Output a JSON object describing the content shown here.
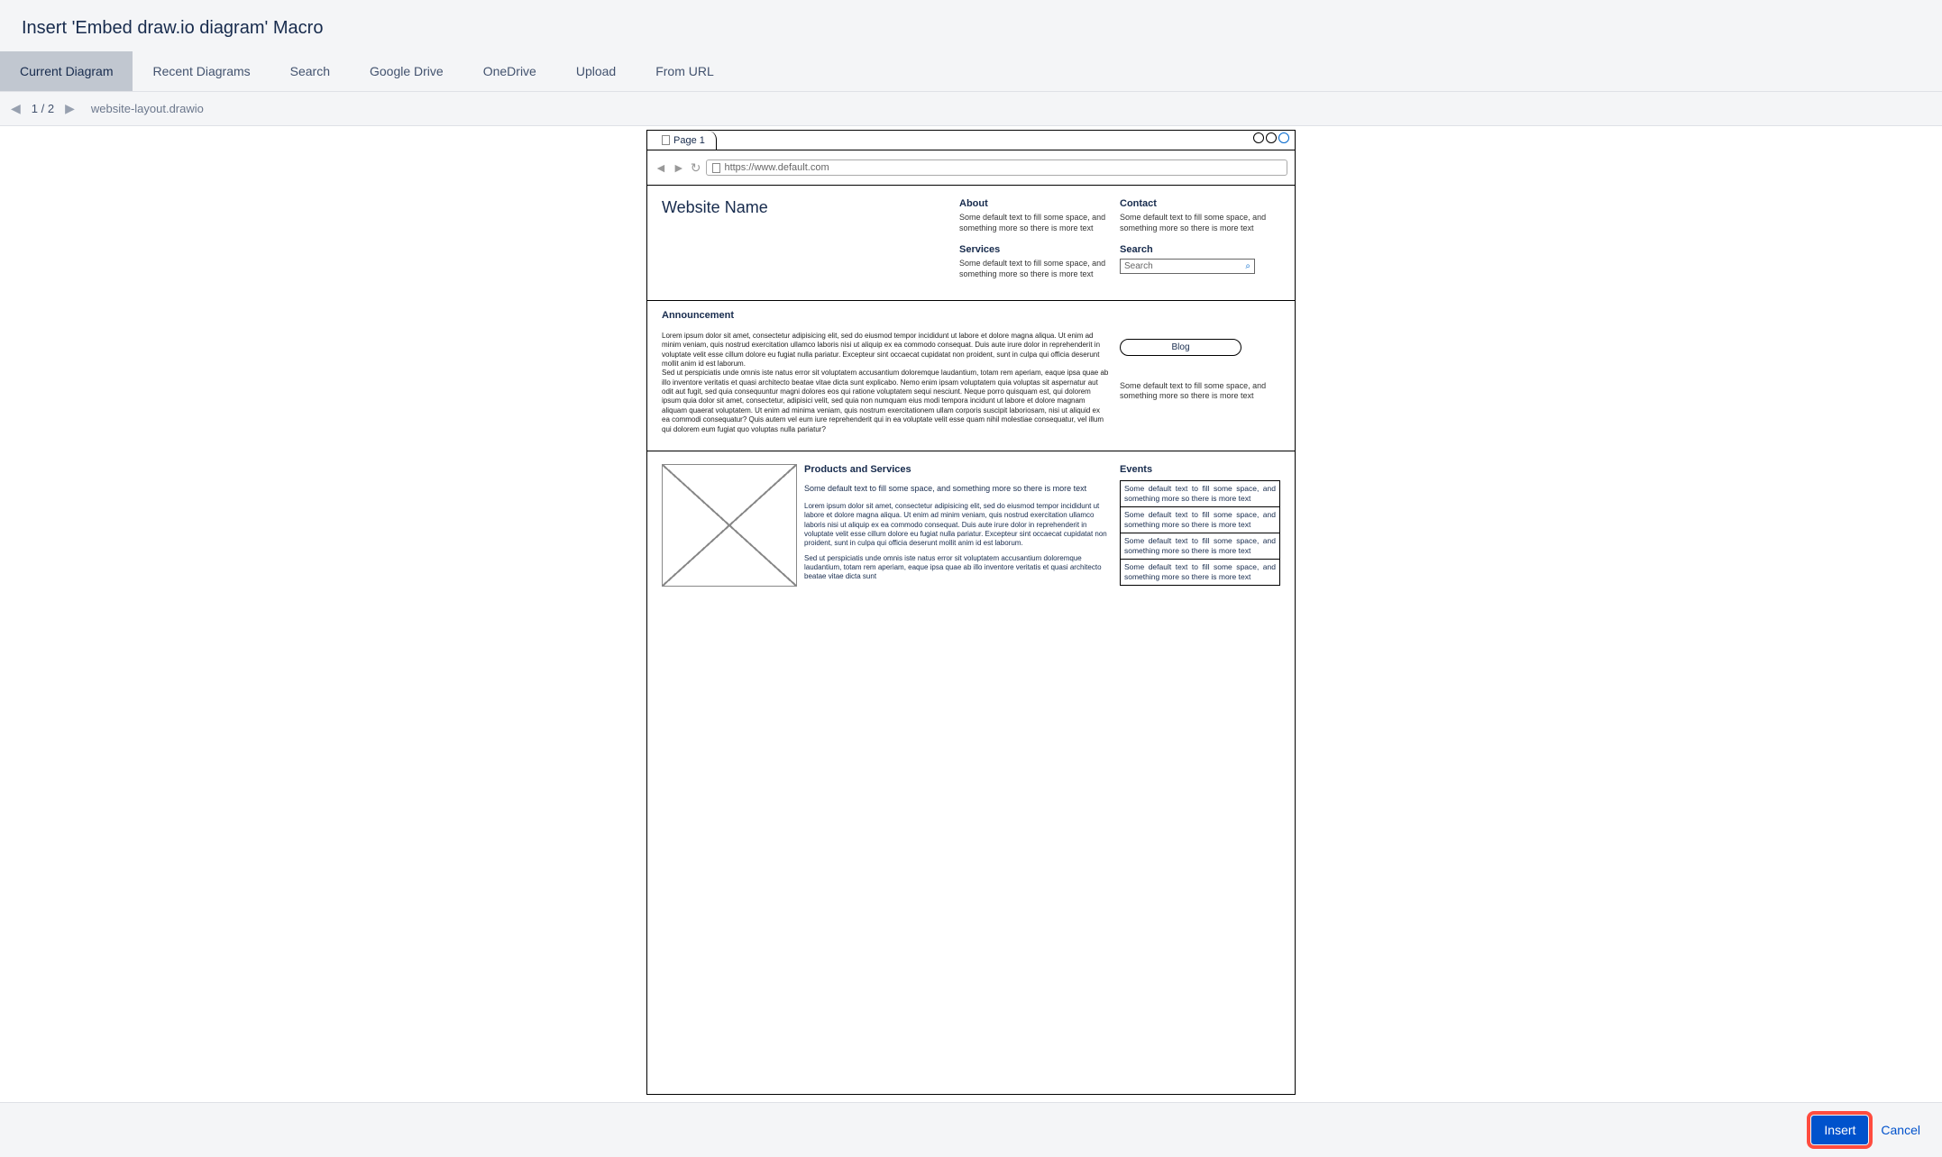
{
  "dialog": {
    "title": "Insert 'Embed draw.io diagram' Macro"
  },
  "tabs": [
    {
      "label": "Current Diagram",
      "active": true
    },
    {
      "label": "Recent Diagrams",
      "active": false
    },
    {
      "label": "Search",
      "active": false
    },
    {
      "label": "Google Drive",
      "active": false
    },
    {
      "label": "OneDrive",
      "active": false
    },
    {
      "label": "Upload",
      "active": false
    },
    {
      "label": "From URL",
      "active": false
    }
  ],
  "toolbar": {
    "page_indicator": "1 / 2",
    "filename": "website-layout.drawio"
  },
  "diagram": {
    "page_tab": "Page 1",
    "url": "https://www.default.com",
    "site_title": "Website Name",
    "header_cols": {
      "about": {
        "label": "About",
        "text": "Some default text to fill some space, and something more so there is more text"
      },
      "services": {
        "label": "Services",
        "text": "Some default text to fill some space, and something more so there is more text"
      },
      "contact": {
        "label": "Contact",
        "text": "Some default text to fill some space, and something more so there is more text"
      },
      "search": {
        "label": "Search",
        "placeholder": "Search"
      }
    },
    "announcement": {
      "title": "Announcement",
      "lorem1": "Lorem ipsum dolor sit amet, consectetur adipisicing elit, sed do eiusmod tempor incididunt ut labore et dolore magna aliqua. Ut enim ad minim veniam, quis nostrud exercitation ullamco laboris nisi ut aliquip ex ea commodo consequat. Duis aute irure dolor in reprehenderit in voluptate velit esse cillum dolore eu fugiat nulla pariatur. Excepteur sint occaecat cupidatat non proident, sunt in culpa qui officia deserunt mollit anim id est laborum.",
      "lorem2": "Sed ut perspiciatis unde omnis iste natus error sit voluptatem accusantium doloremque laudantium, totam rem aperiam, eaque ipsa quae ab illo inventore veritatis et quasi architecto beatae vitae dicta sunt explicabo. Nemo enim ipsam voluptatem quia voluptas sit aspernatur aut odit aut fugit, sed quia consequuntur magni dolores eos qui ratione voluptatem sequi nesciunt. Neque porro quisquam est, qui dolorem ipsum quia dolor sit amet, consectetur, adipisici velit, sed quia non numquam eius modi tempora incidunt ut labore et dolore magnam aliquam quaerat voluptatem. Ut enim ad minima veniam, quis nostrum exercitationem ullam corporis suscipit laboriosam, nisi ut aliquid ex ea commodi consequatur? Quis autem vel eum iure reprehenderit qui in ea voluptate velit esse quam nihil molestiae consequatur, vel illum qui dolorem eum fugiat quo voluptas nulla pariatur?",
      "blog_label": "Blog",
      "blog_text": "Some default text to fill some space, and something more so there is more text"
    },
    "products": {
      "title": "Products and Services",
      "text": "Some default text to fill some space, and something more so there is more text",
      "lorem1": "Lorem ipsum dolor sit amet, consectetur adipisicing elit, sed do eiusmod tempor incididunt ut labore et dolore magna aliqua. Ut enim ad minim veniam, quis nostrud exercitation ullamco laboris nisi ut aliquip ex ea commodo consequat. Duis aute irure dolor in reprehenderit in voluptate velit esse cillum dolore eu fugiat nulla pariatur. Excepteur sint occaecat cupidatat non proident, sunt in culpa qui officia deserunt mollit anim id est laborum.",
      "lorem2": "Sed ut perspiciatis unde omnis iste natus error sit voluptatem accusantium doloremque laudantium, totam rem aperiam, eaque ipsa quae ab illo inventore veritatis et quasi architecto beatae vitae dicta sunt"
    },
    "events": {
      "title": "Events",
      "items": [
        "Some default text to fill some space, and something more so there is more text",
        "Some default text to fill some space, and something more so there is more text",
        "Some default text to fill some space, and something more so there is more text",
        "Some default text to fill some space, and something more so there is more text"
      ]
    }
  },
  "footer": {
    "insert": "Insert",
    "cancel": "Cancel"
  }
}
